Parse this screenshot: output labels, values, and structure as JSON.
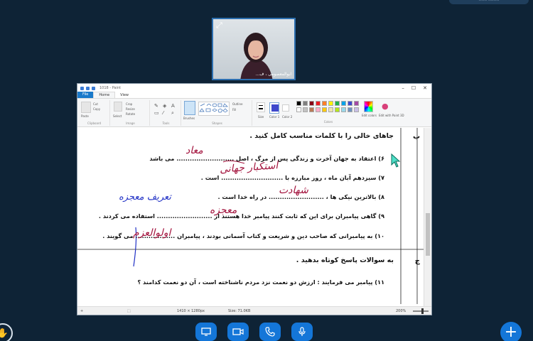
{
  "meeting": {
    "top_right_name": "........ ......",
    "camera": {
      "participant_name": "ابوالمعصومی ، ف...",
      "expand_icon": "expand-icon"
    },
    "controls": [
      "screen-share-icon",
      "camera-icon",
      "phone-icon",
      "microphone-icon"
    ],
    "add_button": "+",
    "raise_hand_icon": "hand-icon"
  },
  "paint": {
    "title": "1018 - Paint",
    "menu": {
      "file": "File",
      "home": "Home",
      "view": "View"
    },
    "ribbon": {
      "clipboard": "Clipboard",
      "image": "Image",
      "tools": "Tools",
      "shapes": "Shapes",
      "colors": "Colors",
      "paste": "Paste",
      "cut": "Cut",
      "copy": "Copy",
      "select": "Select",
      "crop": "Crop",
      "resize": "Resize",
      "rotate": "Rotate",
      "brushes": "Brushes",
      "outline": "Outline",
      "fill": "Fill",
      "size": "Size",
      "color1": "Color 1",
      "color2": "Color 2",
      "edit_colors": "Edit colors",
      "edit_paint3d": "Edit with Paint 3D",
      "swatches": [
        "#000000",
        "#7f7f7f",
        "#880015",
        "#ed1c24",
        "#ff7f27",
        "#fff200",
        "#22b14c",
        "#00a2e8",
        "#3f48cc",
        "#a349a4",
        "#ffffff",
        "#c3c3c3",
        "#b97a57",
        "#ffaec9",
        "#ffc90e",
        "#efe4b0",
        "#b5e61d",
        "#99d9ea",
        "#7092be",
        "#c8bfe7"
      ]
    },
    "status": {
      "dimensions": "1410 × 1280px",
      "size": "Size: 71.0KB",
      "zoom": "200%"
    }
  },
  "worksheet": {
    "section_b": {
      "letter": "ب",
      "title": "جاهای خالی را با کلمات مناسب کامل کنید ."
    },
    "items": [
      {
        "text": "۶) اعتقاد به جهان آخرت و زندگی پس از مرگ ، اصل .......................... می باشد",
        "answer": "معاد"
      },
      {
        "text": "۷) سیزدهم آبان ماه ، روز مبارزه با ............................ است .",
        "answer": "استکبار جهانی"
      },
      {
        "text": "۸) بالاترین نیکی ها ، ......................... در راه خدا است .",
        "answer": "شهادت"
      },
      {
        "text": "۹) گاهی پیامبران برای این که ثابت کنند پیامبر خدا هستند از ......................... استفاده می کردند .",
        "answer": "معجزه"
      },
      {
        "text": "۱۰) به پیامبرانی که صاحب دین و شریعت و کتاب آسمانی بودند ، پیامبران .................. می گویند .",
        "answer": "اولوالعزم"
      }
    ],
    "side_note": "تعریف معجزه",
    "section_c": {
      "letter": "ج",
      "title": "به سوالات پاسخ کوتاه بدهید ."
    },
    "question_11": "۱۱) پیامبر می فرمایند : ارزش دو نعمت نزد مردم ناشناخته است ، آن دو نعمت کدامند ؟"
  }
}
